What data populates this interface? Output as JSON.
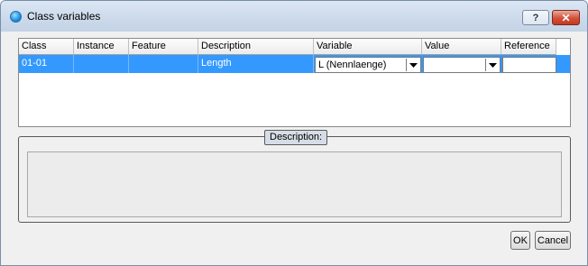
{
  "window": {
    "title": "Class variables",
    "help_label": "?",
    "close_label": "✕"
  },
  "table": {
    "columns": [
      "Class",
      "Instance",
      "Feature",
      "Description",
      "Variable",
      "Value",
      "Reference"
    ],
    "rows": [
      {
        "class": "01-01",
        "instance": "",
        "feature": "",
        "description": "Length",
        "variable": "L (Nennlaenge)",
        "value": "",
        "reference": ""
      }
    ]
  },
  "description_panel": {
    "legend": "Description:",
    "text": ""
  },
  "buttons": {
    "ok": "OK",
    "cancel": "Cancel"
  },
  "colors": {
    "selection": "#3399ff",
    "close_button": "#c5391f"
  }
}
